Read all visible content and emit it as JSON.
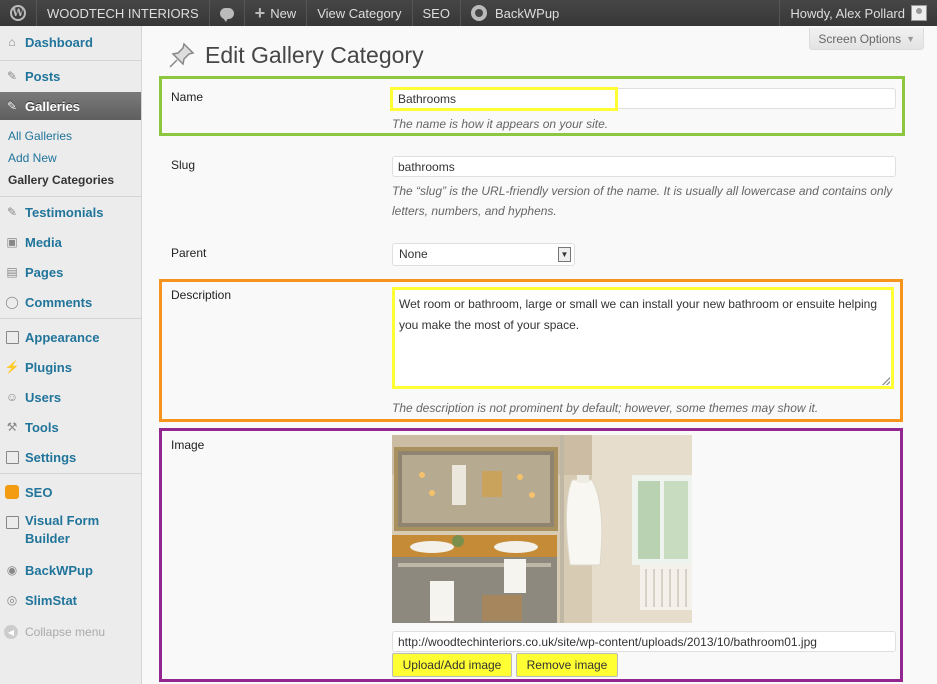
{
  "adminbar": {
    "site_name": "WOODTECH INTERIORS",
    "new_label": "New",
    "view_category": "View Category",
    "seo": "SEO",
    "backwpup": "BackWPup",
    "howdy": "Howdy, Alex Pollard"
  },
  "sidebar": {
    "dashboard": "Dashboard",
    "posts": "Posts",
    "galleries": "Galleries",
    "sub": [
      "All Galleries",
      "Add New",
      "Gallery Categories"
    ],
    "testimonials": "Testimonials",
    "media": "Media",
    "pages": "Pages",
    "comments": "Comments",
    "appearance": "Appearance",
    "plugins": "Plugins",
    "users": "Users",
    "tools": "Tools",
    "settings": "Settings",
    "seo": "SEO",
    "vfb_line1": "Visual Form",
    "vfb_line2": "Builder",
    "backwpup": "BackWPup",
    "slimstat": "SlimStat",
    "collapse": "Collapse menu"
  },
  "main": {
    "screen_options": "Screen Options",
    "title": "Edit Gallery Category",
    "name_label": "Name",
    "name_value": "Bathrooms",
    "name_desc": "The name is how it appears on your site.",
    "slug_label": "Slug",
    "slug_value": "bathrooms",
    "slug_desc_1": "The “slug” is the URL-friendly version of the name. It is usually all lowercase and contains only",
    "slug_desc_2": "letters, numbers, and hyphens.",
    "parent_label": "Parent",
    "parent_value": "None",
    "description_label": "Description",
    "description_value": "Wet room or bathroom, large or small we can install your new bathroom or ensuite helping you make the most of your space.",
    "description_desc": "The description is not prominent by default; however, some themes may show it.",
    "image_label": "Image",
    "image_url": "http://woodtechinteriors.co.uk/site/wp-content/uploads/2013/10/bathroom01.jpg",
    "upload_button": "Upload/Add image",
    "remove_button": "Remove image"
  },
  "colors": {
    "highlight_name": "#8dc63f",
    "highlight_description": "#f7941d",
    "highlight_image": "#92278f",
    "highlight_field": "#ffff33"
  }
}
